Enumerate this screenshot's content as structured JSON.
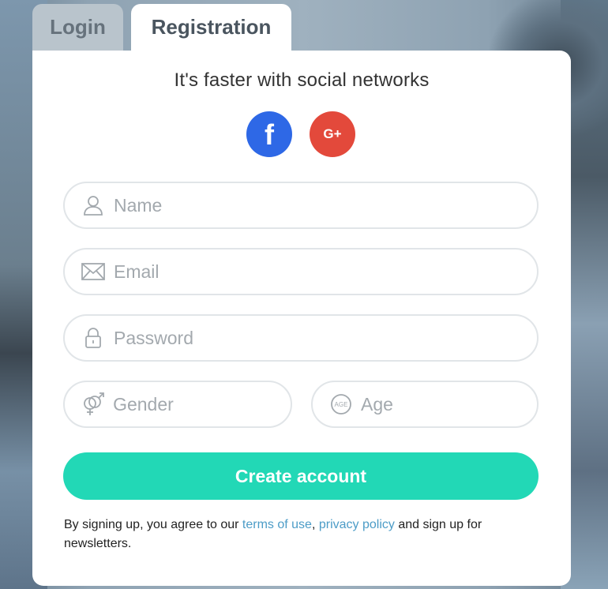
{
  "tabs": {
    "login_label": "Login",
    "registration_label": "Registration"
  },
  "social": {
    "headline": "It's faster with social networks",
    "facebook_glyph": "f",
    "google_glyph": "G+",
    "facebook_color": "#2e68e6",
    "google_color": "#e3493b"
  },
  "form": {
    "name_placeholder": "Name",
    "email_placeholder": "Email",
    "password_placeholder": "Password",
    "gender_placeholder": "Gender",
    "age_placeholder": "Age",
    "create_button": "Create account"
  },
  "terms": {
    "prefix": "By signing up, you agree to our ",
    "terms_link": "terms of use",
    "separator": ", ",
    "privacy_link": "privacy policy",
    "suffix": " and sign up for newsletters."
  },
  "colors": {
    "accent": "#22d8b6",
    "link": "#4c9cc7"
  }
}
